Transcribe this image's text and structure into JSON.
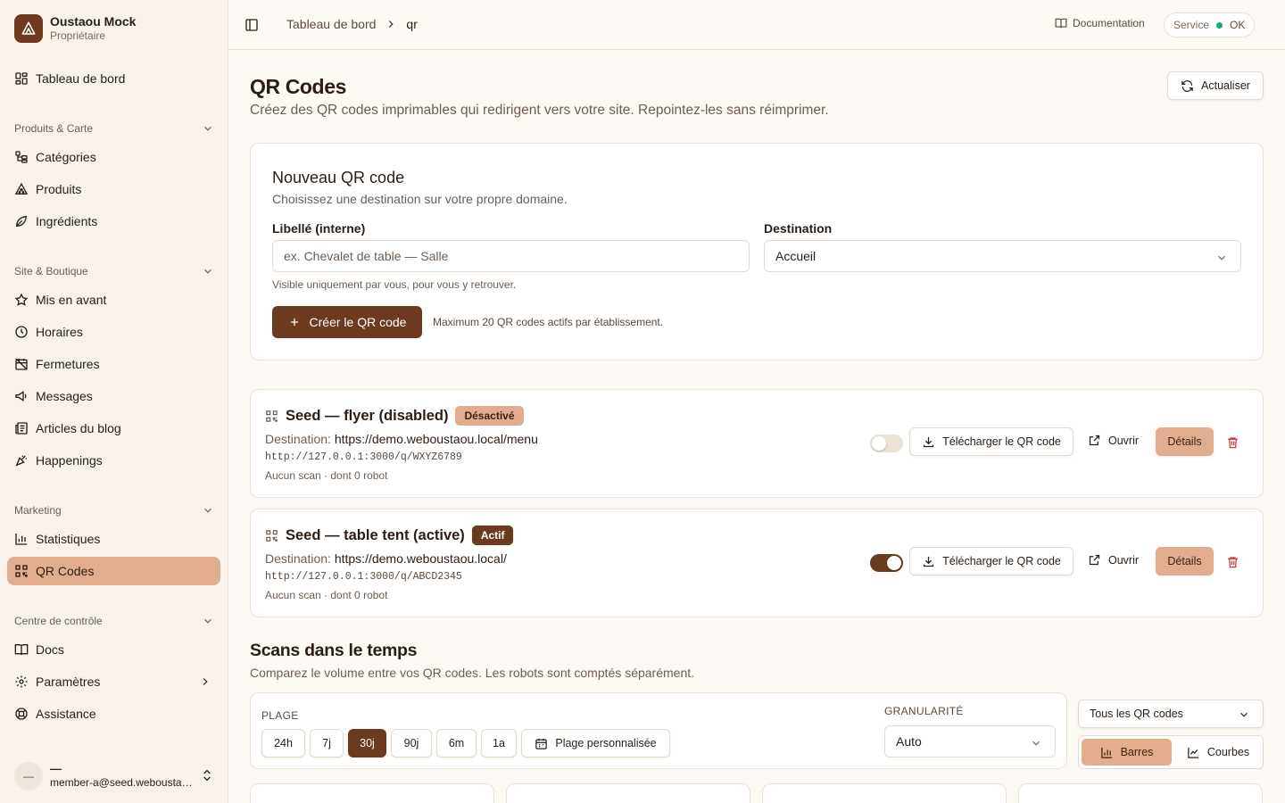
{
  "sidebar": {
    "brand_name": "Oustaou Mock",
    "brand_role": "Propriétaire",
    "dashboard": "Tableau de bord",
    "sections": [
      {
        "title": "Produits & Carte",
        "items": [
          "Catégories",
          "Produits",
          "Ingrédients"
        ]
      },
      {
        "title": "Site & Boutique",
        "items": [
          "Mis en avant",
          "Horaires",
          "Fermetures",
          "Messages",
          "Articles du blog",
          "Happenings"
        ]
      },
      {
        "title": "Marketing",
        "items": [
          "Statistiques",
          "QR Codes"
        ]
      },
      {
        "title": "Centre de contrôle",
        "items": [
          "Docs",
          "Paramètres",
          "Assistance"
        ]
      }
    ],
    "active_item": "QR Codes",
    "user": {
      "avatar": "—",
      "name": "—",
      "email": "member-a@seed.weboustaou.local"
    }
  },
  "topbar": {
    "breadcrumb": [
      "Tableau de bord",
      "qr"
    ],
    "docs_label": "Documentation",
    "service_label": "Service",
    "service_status": "OK"
  },
  "page": {
    "title": "QR Codes",
    "subtitle": "Créez des QR codes imprimables qui redirigent vers votre site. Repointez-les sans réimprimer.",
    "refresh_label": "Actualiser"
  },
  "new_qr": {
    "title": "Nouveau QR code",
    "description": "Choisissez une destination sur votre propre domaine.",
    "label_field": "Libellé (interne)",
    "label_placeholder": "ex. Chevalet de table — Salle",
    "label_help": "Visible uniquement par vous, pour vous y retrouver.",
    "dest_field": "Destination",
    "dest_value": "Accueil",
    "create_label": "Créer le QR code",
    "max_note": "Maximum 20 QR codes actifs par établissement."
  },
  "qr_codes": [
    {
      "name": "Seed — flyer (disabled)",
      "status": "Désactivé",
      "enabled": false,
      "dest_label": "Destination:",
      "dest_url": "https://demo.weboustaou.local/menu",
      "short_link": "http://127.0.0.1:3000/q/WXYZ6789",
      "stats": "Aucun scan · dont 0 robot"
    },
    {
      "name": "Seed — table tent (active)",
      "status": "Actif",
      "enabled": true,
      "dest_label": "Destination:",
      "dest_url": "https://demo.weboustaou.local/",
      "short_link": "http://127.0.0.1:3000/q/ABCD2345",
      "stats": "Aucun scan · dont 0 robot"
    }
  ],
  "actions": {
    "download": "Télécharger le QR code",
    "open": "Ouvrir",
    "details": "Détails"
  },
  "scans": {
    "title": "Scans dans le temps",
    "description": "Comparez le volume entre vos QR codes. Les robots sont comptés séparément.",
    "range_label": "PLAGE",
    "ranges": [
      "24h",
      "7j",
      "30j",
      "90j",
      "6m",
      "1a"
    ],
    "selected_range": "30j",
    "custom_range": "Plage personnalisée",
    "granularity_label": "GRANULARITÉ",
    "granularity_value": "Auto",
    "qr_filter": "Tous les QR codes",
    "view_bars": "Barres",
    "view_lines": "Courbes",
    "selected_view": "Barres"
  },
  "colors": {
    "accent_dark": "#6b3a1f",
    "accent_light": "#e2ad8e",
    "danger": "#d6303a",
    "status_ok": "#19a974"
  }
}
